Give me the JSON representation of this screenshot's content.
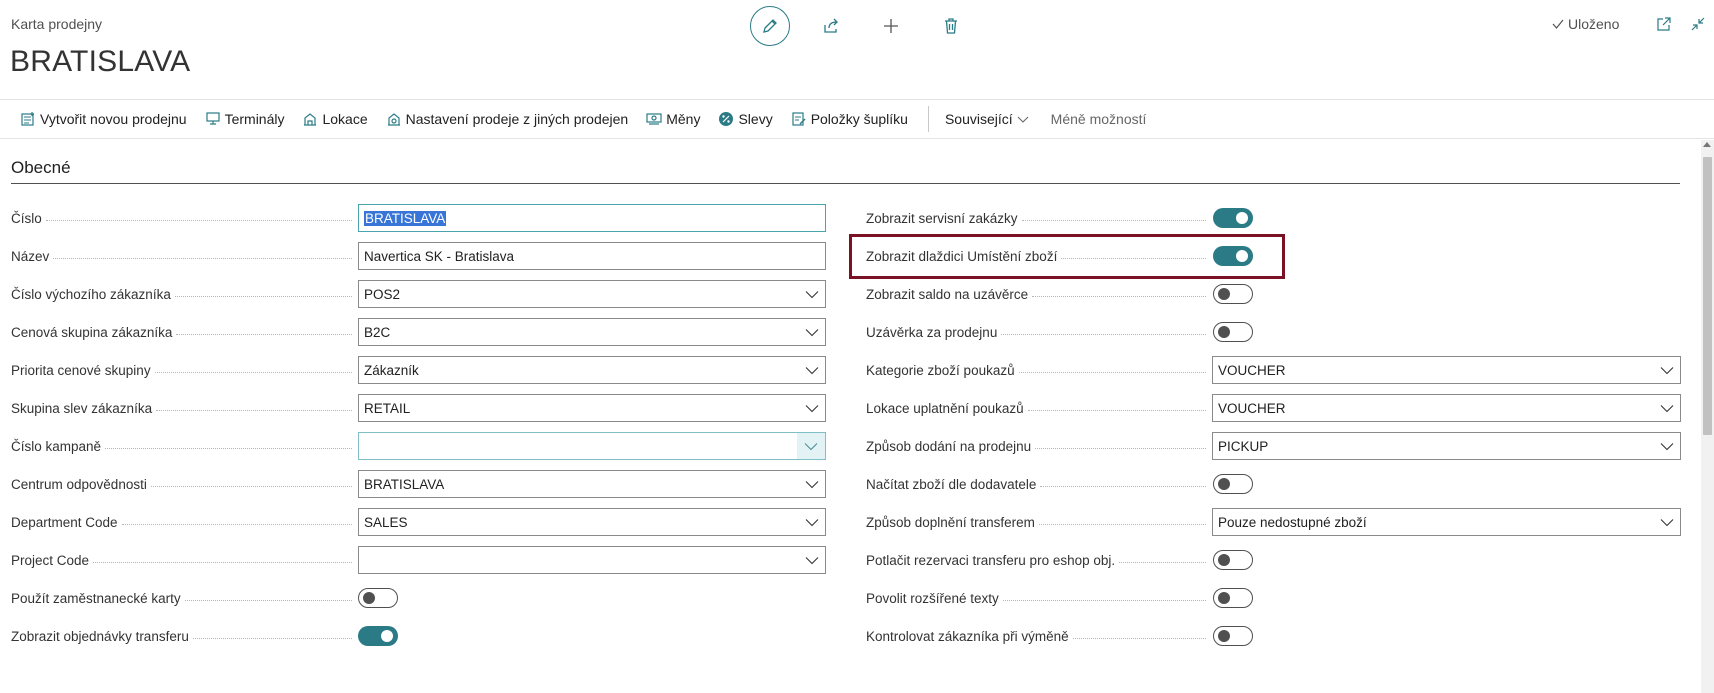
{
  "header": {
    "caption": "Karta prodejny",
    "title": "BRATISLAVA",
    "saved_label": "Uloženo",
    "icons": [
      "pencil-icon",
      "share-icon",
      "plus-icon",
      "trash-icon",
      "open-new-window-icon",
      "collapse-icon"
    ]
  },
  "actions": [
    {
      "label": "Vytvořit novou prodejnu",
      "icon": "new-store-icon"
    },
    {
      "label": "Terminály",
      "icon": "terminal-icon"
    },
    {
      "label": "Lokace",
      "icon": "location-icon"
    },
    {
      "label": "Nastavení prodeje z jiných prodejen",
      "icon": "settings-icon"
    },
    {
      "label": "Měny",
      "icon": "currency-icon"
    },
    {
      "label": "Slevy",
      "icon": "percent-icon"
    },
    {
      "label": "Položky šuplíku",
      "icon": "drawer-items-icon"
    },
    {
      "label": "Související",
      "icon": "chevron-down-icon"
    },
    {
      "label": "Méně možností",
      "icon": ""
    }
  ],
  "section": {
    "title": "Obecné"
  },
  "left_fields": [
    {
      "label": "Číslo",
      "value": "BRATISLAVA"
    },
    {
      "label": "Název",
      "value": "Navertica SK - Bratislava"
    },
    {
      "label": "Číslo výchozího zákazníka",
      "value": "POS2"
    },
    {
      "label": "Cenová skupina zákazníka",
      "value": "B2C"
    },
    {
      "label": "Priorita cenové skupiny",
      "value": "Zákazník"
    },
    {
      "label": "Skupina slev zákazníka",
      "value": "RETAIL"
    },
    {
      "label": "Číslo kampaně",
      "value": ""
    },
    {
      "label": "Centrum odpovědnosti",
      "value": "BRATISLAVA"
    },
    {
      "label": "Department Code",
      "value": "SALES"
    },
    {
      "label": "Project Code",
      "value": ""
    },
    {
      "label": "Použít zaměstnanecké karty",
      "value": "off"
    },
    {
      "label": "Zobrazit objednávky transferu",
      "value": "on"
    }
  ],
  "right_fields": [
    {
      "label": "Zobrazit servisní zakázky",
      "value": "on"
    },
    {
      "label": "Zobrazit dlaždici Umístění zboží",
      "value": "on"
    },
    {
      "label": "Zobrazit saldo na uzávěrce",
      "value": "off"
    },
    {
      "label": "Uzávěrka za prodejnu",
      "value": "off"
    },
    {
      "label": "Kategorie zboží poukazů",
      "value": "VOUCHER"
    },
    {
      "label": "Lokace uplatnění poukazů",
      "value": "VOUCHER"
    },
    {
      "label": "Způsob dodání na prodejnu",
      "value": "PICKUP"
    },
    {
      "label": "Načítat zboží dle dodavatele",
      "value": "off"
    },
    {
      "label": "Způsob doplnění transferem",
      "value": "Pouze nedostupné zboží"
    },
    {
      "label": "Potlačit rezervaci transferu pro eshop obj.",
      "value": "off"
    },
    {
      "label": "Povolit rozšířené texty",
      "value": "off"
    },
    {
      "label": "Kontrolovat zákazníka při výměně",
      "value": "off"
    }
  ],
  "colors": {
    "accent": "#2b7b87",
    "highlight_border": "#7a1124",
    "selection": "#3875d7"
  }
}
